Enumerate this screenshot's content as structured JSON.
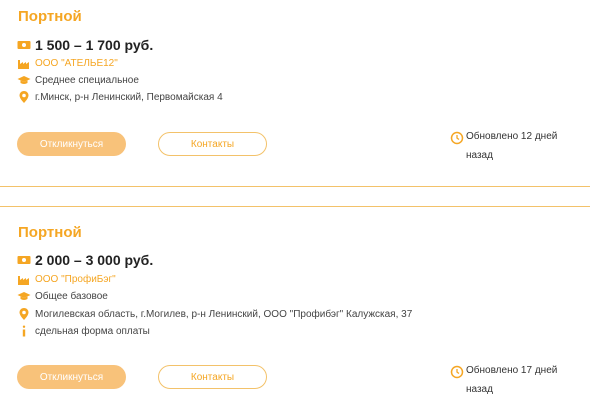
{
  "vacancies": [
    {
      "title": "Портной",
      "salary": "1 500 – 1 700 руб.",
      "company": "ООО \"АТЕЛЬЕ12\"",
      "education": "Среднее специальное",
      "address": "г.Минск, р-н Ленинский, Первомайская 4",
      "respond_label": "Откликнуться",
      "contacts_label": "Контакты",
      "updated_line1": "Обновлено 12 дней",
      "updated_line2": "назад"
    },
    {
      "title": "Портной",
      "salary": "2 000 – 3 000 руб.",
      "company": "ООО \"ПрофиБэг\"",
      "education": "Общее базовое",
      "address": "Могилевская область, г.Могилев, р-н Ленинский, ООО \"Профибэг\" Калужская, 37",
      "payment": "сдельная форма оплаты",
      "respond_label": "Откликнуться",
      "contacts_label": "Контакты",
      "updated_line1": "Обновлено 17 дней",
      "updated_line2": "назад"
    }
  ],
  "colors": {
    "accent": "#f5a623",
    "button_fill": "#f8c27a",
    "divider": "#f3c26a"
  },
  "icons": {
    "salary": "money-icon",
    "company": "factory-icon",
    "education": "graduation-cap-icon",
    "address": "map-pin-icon",
    "payment": "info-icon",
    "updated": "clock-icon"
  }
}
